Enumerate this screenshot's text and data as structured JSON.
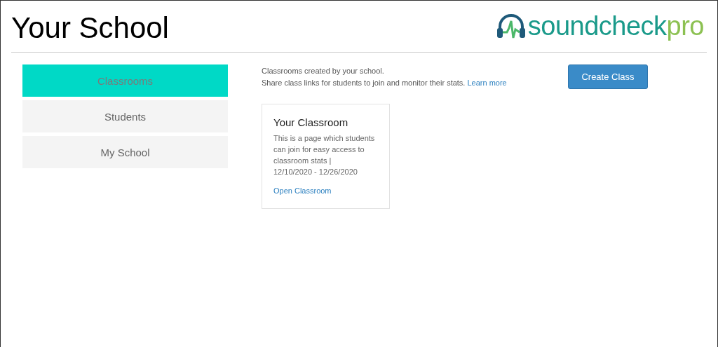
{
  "header": {
    "title": "Your School",
    "logo": {
      "main": "soundcheck",
      "suffix": "pro"
    }
  },
  "sidebar": {
    "items": [
      {
        "label": "Classrooms",
        "selected": true
      },
      {
        "label": "Students",
        "selected": false
      },
      {
        "label": "My School",
        "selected": false
      }
    ]
  },
  "intro": {
    "lines": [
      "Classrooms created by your school.",
      "Share class links for students to join and monitor their stats."
    ],
    "link": "Learn more"
  },
  "create_button": "Create Class",
  "classrooms": [
    {
      "title": "Your Classroom",
      "description": "This is a page which students can join for easy access to classroom stats |",
      "dates": "12/10/2020 - 12/26/2020",
      "link": "Open Classroom"
    }
  ]
}
